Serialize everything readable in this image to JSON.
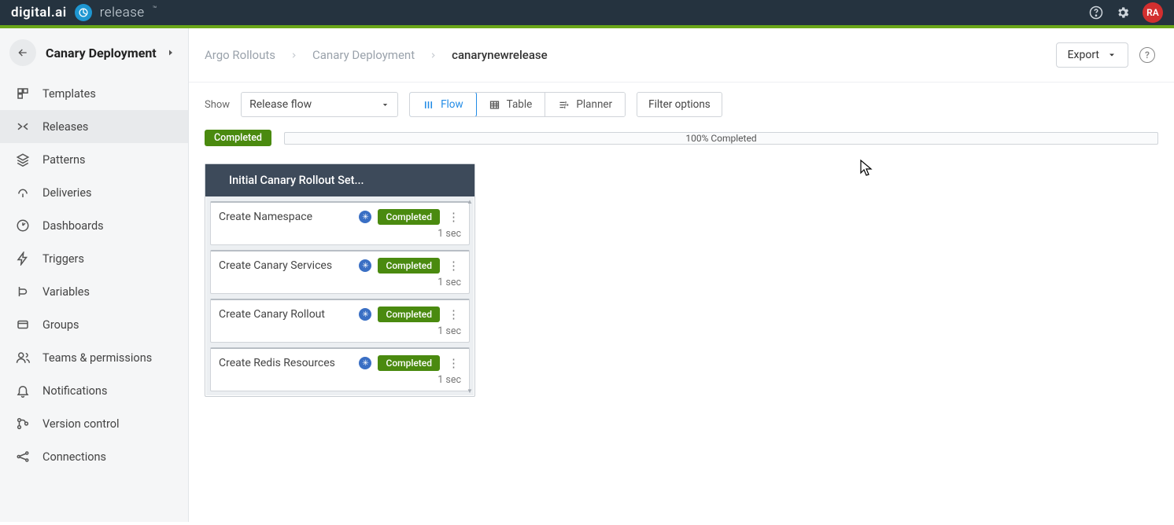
{
  "header": {
    "brand_left": "digital.ai",
    "brand_right": "release",
    "avatar_initials": "RA"
  },
  "sidebar": {
    "title": "Canary Deployment",
    "items": [
      {
        "label": "Templates"
      },
      {
        "label": "Releases"
      },
      {
        "label": "Patterns"
      },
      {
        "label": "Deliveries"
      },
      {
        "label": "Dashboards"
      },
      {
        "label": "Triggers"
      },
      {
        "label": "Variables"
      },
      {
        "label": "Groups"
      },
      {
        "label": "Teams & permissions"
      },
      {
        "label": "Notifications"
      },
      {
        "label": "Version control"
      },
      {
        "label": "Connections"
      }
    ],
    "active_index": 1
  },
  "breadcrumb": {
    "items": [
      "Argo Rollouts",
      "Canary Deployment",
      "canarynewrelease"
    ]
  },
  "actions": {
    "export_label": "Export"
  },
  "toolbar": {
    "show_label": "Show",
    "select_value": "Release flow",
    "views": [
      {
        "label": "Flow"
      },
      {
        "label": "Table"
      },
      {
        "label": "Planner"
      }
    ],
    "active_view": 0,
    "filter_label": "Filter options"
  },
  "progress": {
    "status_badge": "Completed",
    "text": "100% Completed"
  },
  "phase": {
    "title": "Initial Canary Rollout Set...",
    "tasks": [
      {
        "name": "Create Namespace",
        "status": "Completed",
        "duration": "1 sec"
      },
      {
        "name": "Create Canary Services",
        "status": "Completed",
        "duration": "1 sec"
      },
      {
        "name": "Create Canary Rollout",
        "status": "Completed",
        "duration": "1 sec"
      },
      {
        "name": "Create Redis Resources",
        "status": "Completed",
        "duration": "1 sec"
      }
    ]
  }
}
